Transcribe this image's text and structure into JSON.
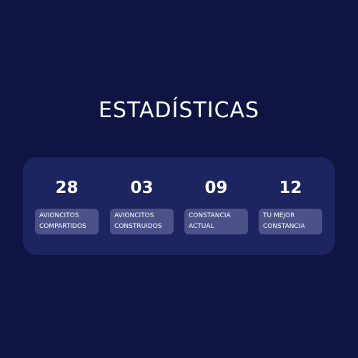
{
  "page": {
    "title": "ESTADÍSTICAS"
  },
  "stats": [
    {
      "value": "28",
      "label_line1": "AVIONCITOS",
      "label_line2": "COMPARTIDOS"
    },
    {
      "value": "03",
      "label_line1": "AVIONCITOS",
      "label_line2": "CONSTRUIDOS"
    },
    {
      "value": "09",
      "label_line1": "CONSTANCIA",
      "label_line2": "ACTUAL"
    },
    {
      "value": "12",
      "label_line1": "TU MEJOR",
      "label_line2": "CONSTANCIA"
    }
  ],
  "colors": {
    "background": "#0f1442",
    "panel": "#1d2560",
    "label_chip": "#4b5288",
    "text": "#ffffff"
  }
}
